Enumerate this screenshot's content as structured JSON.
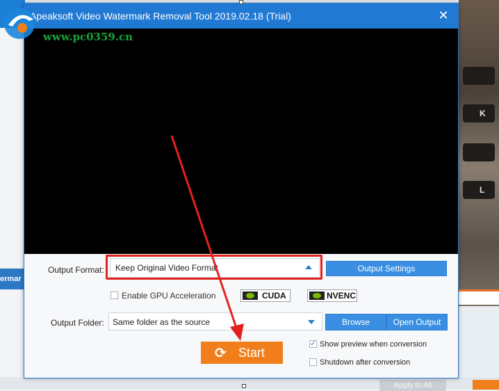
{
  "window": {
    "title": "Apeaksoft Video Watermark Removal Tool 2019.02.18 (Trial)",
    "close_glyph": "✕"
  },
  "watermark": {
    "url": "www.pc0359.cn",
    "logo_colors": {
      "primary": "#1c86dd",
      "accent": "#f07f1b"
    }
  },
  "background": {
    "left_tab_text": "ermar",
    "right_keys": [
      "",
      "K",
      "",
      "L"
    ],
    "apply_button": "Apply to All"
  },
  "output_format": {
    "label": "Output Format:",
    "value": "Keep Original Video Format",
    "settings_button": "Output Settings"
  },
  "gpu": {
    "checkbox_label": "Enable GPU Acceleration",
    "checked": false,
    "cuda_label": "CUDA",
    "nvenc_label": "NVENC"
  },
  "output_folder": {
    "label": "Output Folder:",
    "value": "Same folder as the source",
    "browse_button": "Browse",
    "open_button": "Open Output"
  },
  "start": {
    "label": "Start"
  },
  "options": {
    "show_preview": {
      "label": "Show preview when conversion",
      "checked": true
    },
    "shutdown": {
      "label": "Shutdown after conversion",
      "checked": false
    }
  },
  "colors": {
    "titlebar": "#2079d3",
    "start_button": "#f07f1b",
    "highlight": "#e3221f",
    "button_blue": "#3a8fe3"
  }
}
